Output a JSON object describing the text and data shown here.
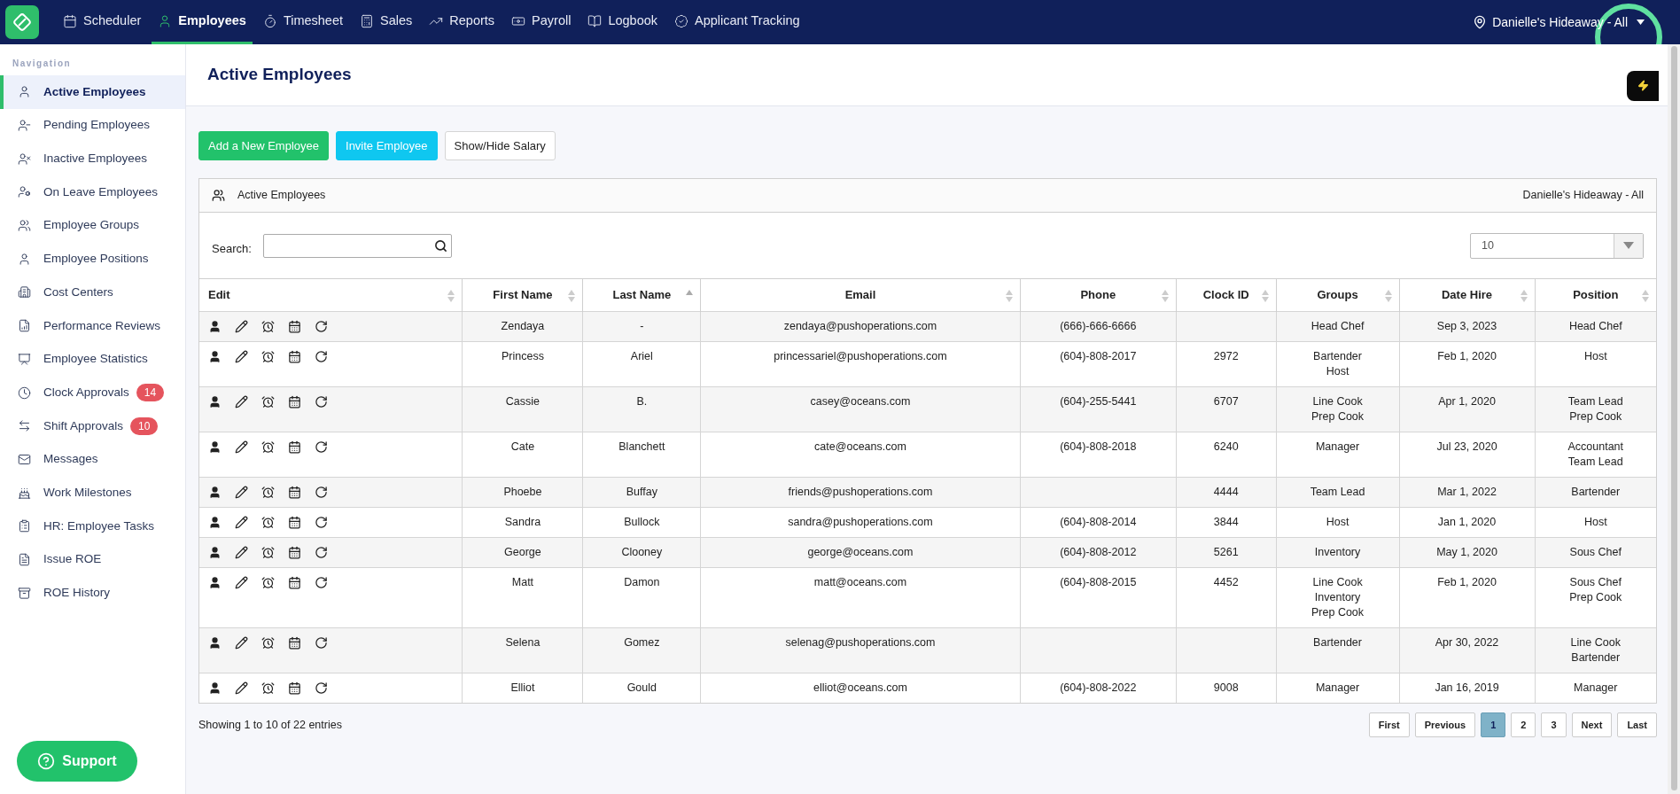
{
  "top_nav": {
    "items": [
      {
        "label": "Scheduler",
        "selected": false
      },
      {
        "label": "Employees",
        "selected": true
      },
      {
        "label": "Timesheet",
        "selected": false
      },
      {
        "label": "Sales",
        "selected": false
      },
      {
        "label": "Reports",
        "selected": false
      },
      {
        "label": "Payroll",
        "selected": false
      },
      {
        "label": "Logbook",
        "selected": false
      },
      {
        "label": "Applicant Tracking",
        "selected": false
      }
    ],
    "location": "Danielle's Hideaway - All"
  },
  "sidebar": {
    "heading": "Navigation",
    "items": [
      {
        "label": "Active Employees",
        "selected": true
      },
      {
        "label": "Pending Employees",
        "selected": false
      },
      {
        "label": "Inactive Employees",
        "selected": false
      },
      {
        "label": "On Leave Employees",
        "selected": false
      },
      {
        "label": "Employee Groups",
        "selected": false
      },
      {
        "label": "Employee Positions",
        "selected": false
      },
      {
        "label": "Cost Centers",
        "selected": false
      },
      {
        "label": "Performance Reviews",
        "selected": false
      },
      {
        "label": "Employee Statistics",
        "selected": false
      },
      {
        "label": "Clock Approvals",
        "selected": false,
        "badge": "14"
      },
      {
        "label": "Shift Approvals",
        "selected": false,
        "badge": "10"
      },
      {
        "label": "Messages",
        "selected": false
      },
      {
        "label": "Work Milestones",
        "selected": false
      },
      {
        "label": "HR: Employee Tasks",
        "selected": false
      },
      {
        "label": "Issue ROE",
        "selected": false
      },
      {
        "label": "ROE History",
        "selected": false
      }
    ]
  },
  "support_button": "Support",
  "page_title": "Active Employees",
  "actions": [
    {
      "label": "Add a New Employee",
      "kind": "green"
    },
    {
      "label": "Invite Employee",
      "kind": "cyan"
    },
    {
      "label": "Show/Hide Salary",
      "kind": "plain"
    }
  ],
  "panel": {
    "title": "Active Employees",
    "location": "Danielle's Hideaway - All",
    "search_label": "Search:",
    "page_size": "10"
  },
  "table": {
    "columns": [
      {
        "label": "Edit",
        "sorted": false
      },
      {
        "label": "First Name",
        "sorted": false
      },
      {
        "label": "Last Name",
        "sorted": true
      },
      {
        "label": "Email",
        "sorted": false
      },
      {
        "label": "Phone",
        "sorted": false
      },
      {
        "label": "Clock ID",
        "sorted": false
      },
      {
        "label": "Groups",
        "sorted": false
      },
      {
        "label": "Date Hire",
        "sorted": false
      },
      {
        "label": "Position",
        "sorted": false
      }
    ],
    "rows": [
      {
        "first": "Zendaya",
        "last": "-",
        "email": "zendaya@pushoperations.com",
        "phone": "(666)-666-6666",
        "clock_id": "",
        "groups": [
          "Head Chef"
        ],
        "date_hire": "Sep 3, 2023",
        "position": [
          "Head Chef"
        ]
      },
      {
        "first": "Princess",
        "last": "Ariel",
        "email": "princessariel@pushoperations.com",
        "phone": "(604)-808-2017",
        "clock_id": "2972",
        "groups": [
          "Bartender",
          "Host"
        ],
        "date_hire": "Feb 1, 2020",
        "position": [
          "Host"
        ]
      },
      {
        "first": "Cassie",
        "last": "B.",
        "email": "casey@oceans.com",
        "phone": "(604)-255-5441",
        "clock_id": "6707",
        "groups": [
          "Line Cook",
          "Prep Cook"
        ],
        "date_hire": "Apr 1, 2020",
        "position": [
          "Team Lead",
          "Prep Cook"
        ]
      },
      {
        "first": "Cate",
        "last": "Blanchett",
        "email": "cate@oceans.com",
        "phone": "(604)-808-2018",
        "clock_id": "6240",
        "groups": [
          "Manager"
        ],
        "date_hire": "Jul 23, 2020",
        "position": [
          "Accountant",
          "Team Lead"
        ]
      },
      {
        "first": "Phoebe",
        "last": "Buffay",
        "email": "friends@pushoperations.com",
        "phone": "",
        "clock_id": "4444",
        "groups": [
          "Team Lead"
        ],
        "date_hire": "Mar 1, 2022",
        "position": [
          "Bartender"
        ]
      },
      {
        "first": "Sandra",
        "last": "Bullock",
        "email": "sandra@pushoperations.com",
        "phone": "(604)-808-2014",
        "clock_id": "3844",
        "groups": [
          "Host"
        ],
        "date_hire": "Jan 1, 2020",
        "position": [
          "Host"
        ]
      },
      {
        "first": "George",
        "last": "Clooney",
        "email": "george@oceans.com",
        "phone": "(604)-808-2012",
        "clock_id": "5261",
        "groups": [
          "Inventory"
        ],
        "date_hire": "May 1, 2020",
        "position": [
          "Sous Chef"
        ]
      },
      {
        "first": "Matt",
        "last": "Damon",
        "email": "matt@oceans.com",
        "phone": "(604)-808-2015",
        "clock_id": "4452",
        "groups": [
          "Line Cook",
          "Inventory",
          "Prep Cook"
        ],
        "date_hire": "Feb 1, 2020",
        "position": [
          "Sous Chef",
          "Prep Cook"
        ]
      },
      {
        "first": "Selena",
        "last": "Gomez",
        "email": "selenag@pushoperations.com",
        "phone": "",
        "clock_id": "",
        "groups": [
          "Bartender"
        ],
        "date_hire": "Apr 30, 2022",
        "position": [
          "Line Cook",
          "Bartender"
        ]
      },
      {
        "first": "Elliot",
        "last": "Gould",
        "email": "elliot@oceans.com",
        "phone": "(604)-808-2022",
        "clock_id": "9008",
        "groups": [
          "Manager"
        ],
        "date_hire": "Jan 16, 2019",
        "position": [
          "Manager"
        ]
      }
    ]
  },
  "footer": {
    "info": "Showing 1 to 10 of 22 entries",
    "pages": [
      {
        "label": "First",
        "selected": false
      },
      {
        "label": "Previous",
        "selected": false
      },
      {
        "label": "1",
        "selected": true
      },
      {
        "label": "2",
        "selected": false
      },
      {
        "label": "3",
        "selected": false
      },
      {
        "label": "Next",
        "selected": false
      },
      {
        "label": "Last",
        "selected": false
      }
    ]
  }
}
